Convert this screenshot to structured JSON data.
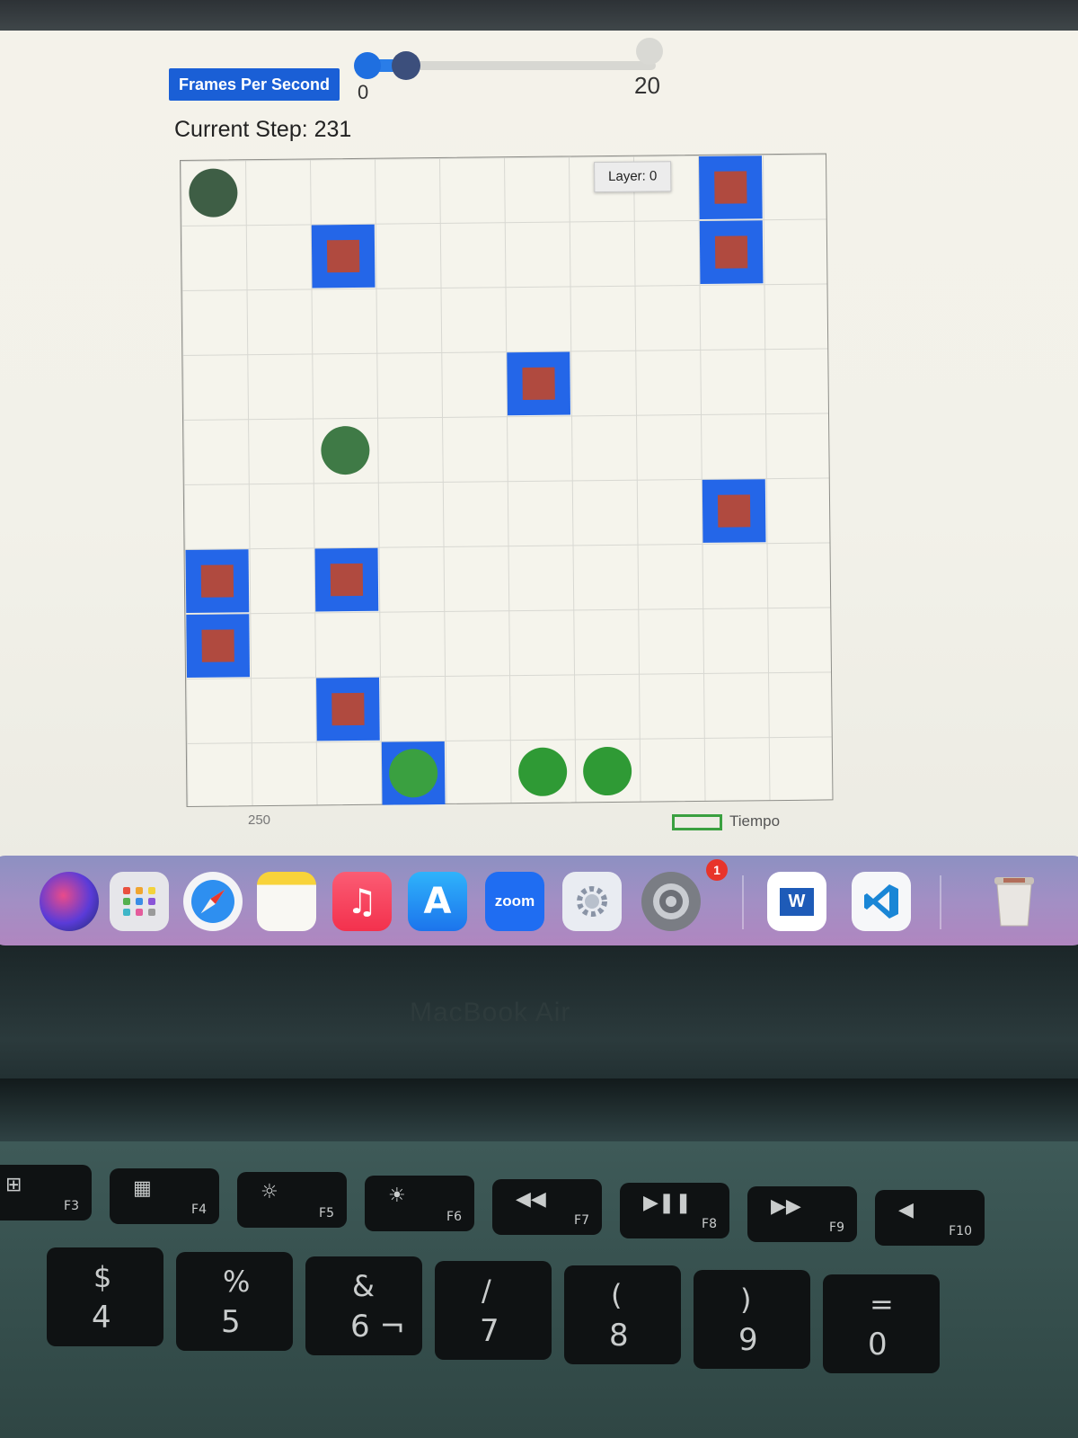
{
  "controls": {
    "fps_label": "Frames Per Second",
    "slider_min": "0",
    "slider_max": "20",
    "slider_value": 2
  },
  "sim": {
    "current_step": "Current Step: 231",
    "layer_badge": "Layer: 0",
    "axis_tick": "250",
    "legend_label": "Tiempo"
  },
  "grid": {
    "rows": 10,
    "cols": 10,
    "boxes": [
      {
        "col": 8,
        "row": 0
      },
      {
        "col": 8,
        "row": 1
      },
      {
        "col": 2,
        "row": 1
      },
      {
        "col": 5,
        "row": 3
      },
      {
        "col": 8,
        "row": 5
      },
      {
        "col": 0,
        "row": 6
      },
      {
        "col": 2,
        "row": 6
      },
      {
        "col": 0,
        "row": 7
      },
      {
        "col": 2,
        "row": 8
      }
    ],
    "circles": [
      {
        "col": 0,
        "row": 0,
        "color": "#3e5e45"
      },
      {
        "col": 2,
        "row": 4,
        "color": "#3f7a46"
      },
      {
        "col": 3,
        "row": 9,
        "color": "#3aa040",
        "on_box": true
      },
      {
        "col": 5,
        "row": 9,
        "color": "#2f9a35"
      },
      {
        "col": 6,
        "row": 9,
        "color": "#2f9a35"
      }
    ],
    "box_color": "#2466e8",
    "box_inner_color": "#b04a3f"
  },
  "dock": {
    "icons": [
      "siri-icon",
      "launchpad-icon",
      "safari-icon",
      "notes-icon",
      "music-icon",
      "app-store-icon",
      "zoom-icon",
      "settings-gear-icon",
      "system-preferences-icon",
      "word-icon",
      "vscode-icon",
      "trash-icon"
    ],
    "zoom_label": "zoom",
    "word_label": "W",
    "notification_count": "1"
  },
  "laptop": {
    "brand_label": "MacBook Air",
    "fkeys": [
      {
        "label": "F3",
        "sym": "⊞"
      },
      {
        "label": "F4",
        "sym": "▦"
      },
      {
        "label": "F5",
        "sym": "☼"
      },
      {
        "label": "F6",
        "sym": "☀"
      },
      {
        "label": "F7",
        "sym": "◀◀"
      },
      {
        "label": "F8",
        "sym": "▶❚❚"
      },
      {
        "label": "F9",
        "sym": "▶▶"
      },
      {
        "label": "F10",
        "sym": "◀"
      }
    ],
    "numkeys": [
      {
        "top": "$",
        "bottom": "4"
      },
      {
        "top": "%",
        "bottom": "5"
      },
      {
        "top": "&",
        "bottom": "6 ¬"
      },
      {
        "top": "/",
        "bottom": "7"
      },
      {
        "top": "(",
        "bottom": "8"
      },
      {
        "top": ")",
        "bottom": "9"
      },
      {
        "top": "=",
        "bottom": "0"
      }
    ]
  }
}
